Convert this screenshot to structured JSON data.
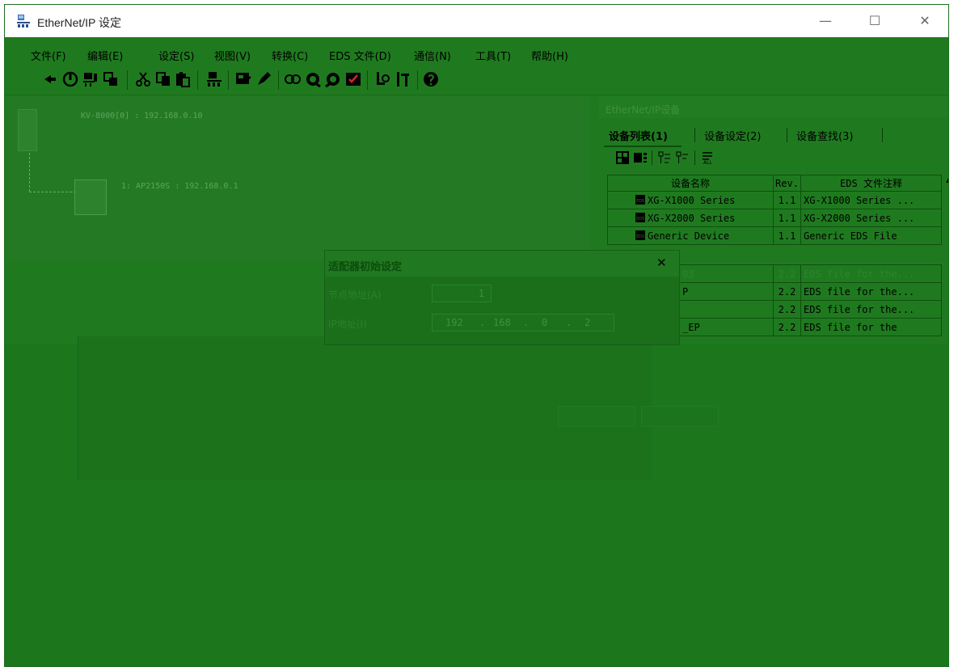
{
  "window": {
    "title": "EtherNet/IP 设定",
    "controls": {
      "minimize": "—",
      "maximize": "☐",
      "close": "✕"
    }
  },
  "menu": [
    {
      "label": "文件(F)"
    },
    {
      "label": "编辑(E)"
    },
    {
      "label": "设定(S)"
    },
    {
      "label": "视图(V)"
    },
    {
      "label": "转换(C)"
    },
    {
      "label": "EDS 文件(D)"
    },
    {
      "label": "通信(N)"
    },
    {
      "label": "工具(T)"
    },
    {
      "label": "帮助(H)"
    }
  ],
  "toolbar": {
    "icons": [
      "pin-icon",
      "power-icon",
      "device-icon",
      "copy-device-icon",
      "cut-icon",
      "copy-icon",
      "paste-icon",
      "network-icon",
      "monitor-icon",
      "write-icon",
      "connect-icon",
      "upload-icon",
      "download-icon",
      "check-icon",
      "find-icon",
      "settings-icon",
      "help-icon"
    ]
  },
  "canvas": {
    "plc_label": "KV-8000[0] : 192.168.0.10",
    "adapter_label": "1: AP2150S : 192.168.0.1"
  },
  "panel": {
    "title": "EtherNet/IP设备",
    "tabs": [
      {
        "label": "设备列表(1)",
        "active": true
      },
      {
        "label": "设备设定(2)",
        "active": false
      },
      {
        "label": "设备查找(3)",
        "active": false
      }
    ],
    "table": {
      "headers": [
        "设备名称",
        "Rev.",
        "EDS 文件注释"
      ],
      "rows": [
        {
          "name": "XG-X1000 Series",
          "rev": "1.1",
          "comment": "XG-X1000 Series ..."
        },
        {
          "name": "XG-X2000 Series",
          "rev": "1.1",
          "comment": "XG-X2000 Series ..."
        },
        {
          "name": "Generic Device",
          "rev": "1.1",
          "comment": "Generic EDS File"
        },
        {
          "name": "",
          "rev": "",
          "comment": ""
        },
        {
          "name": "03",
          "rev": "2.2",
          "comment": "EDS file for the..."
        },
        {
          "name": "P",
          "rev": "2.2",
          "comment": "EDS file for the..."
        },
        {
          "name": "",
          "rev": "2.2",
          "comment": "EDS file for the..."
        },
        {
          "name": "_EP",
          "rev": "2.2",
          "comment": "EDS file for the"
        }
      ]
    }
  },
  "dialog": {
    "title": "适配器初始设定",
    "close": "✕",
    "node_address_label": "节点地址(A)",
    "node_address_value": "1",
    "ip_label": "IP地址(I)",
    "ip": [
      "192",
      "168",
      "0",
      "2"
    ]
  }
}
